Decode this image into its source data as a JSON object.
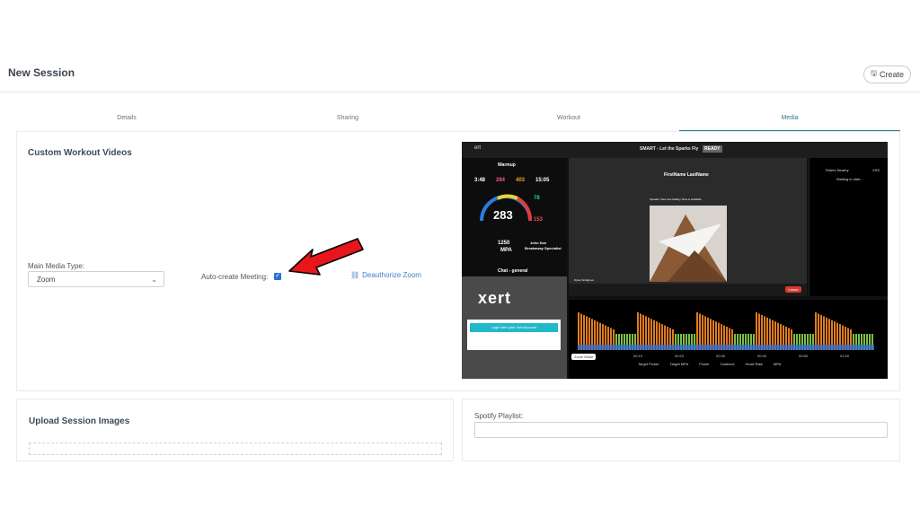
{
  "header": {
    "title": "New Session",
    "create_label": "Create"
  },
  "tabs": [
    {
      "label": "Details",
      "active": false
    },
    {
      "label": "Sharing",
      "active": false
    },
    {
      "label": "Workout",
      "active": false
    },
    {
      "label": "Media",
      "active": true
    }
  ],
  "media": {
    "heading": "Custom Workout Videos",
    "main_media_label": "Main Media Type:",
    "main_media_value": "Zoom",
    "auto_create_label": "Auto-create Meeting:",
    "auto_create_checked": true,
    "deauthorize_label": "Deauthorize Zoom"
  },
  "preview": {
    "logo": "ert",
    "title": "SMART - Let the Sparks Fly",
    "status": "READY",
    "interval_name": "Warmup",
    "stats": [
      {
        "label": "SMART Interval",
        "value": "3:48",
        "color": "#ffffff"
      },
      {
        "label": "SMART Target",
        "value": "284",
        "color": "#ff4fa0"
      },
      {
        "label": "Now",
        "value": "403",
        "color": "#f5a623"
      },
      {
        "label": "Workout",
        "value": "15:05",
        "color": "#ffffff"
      }
    ],
    "power": "283",
    "rpm": "78",
    "bpm": "153",
    "mpa": "1250",
    "mpa_label": "MPA",
    "rider": "John Doe",
    "rider_sub": "Breakaway Specialist",
    "chat_title": "Chat - general",
    "chat_brand": "xert",
    "chat_login": "Login with your Xert Account",
    "participant_name": "FirstName LastName",
    "speaker_notice": "Speaker View and Gallery View is available",
    "self_name": "Dylan Snidgrove",
    "leave_label": "Leave",
    "viewers_title": "Riders Nearby",
    "viewers_col": "XSS",
    "viewers_status": "Waiting to start...",
    "zoom_mode": "Zoom Mode",
    "time_ticks": [
      "00:10",
      "00:20",
      "00:30",
      "00:40",
      "00:50",
      "01:00"
    ],
    "legend": [
      "Target Power",
      "Target MPA",
      "Power",
      "Cadence",
      "Heart Rate",
      "MPA"
    ]
  },
  "upload": {
    "heading": "Upload Session Images"
  },
  "spotify": {
    "label": "Spotify Playlist:",
    "value": ""
  },
  "colors": {
    "accent": "#2b7c91",
    "arrow": "#e8161b",
    "checkbox": "#2b6fd6",
    "link": "#3c7fc6"
  }
}
